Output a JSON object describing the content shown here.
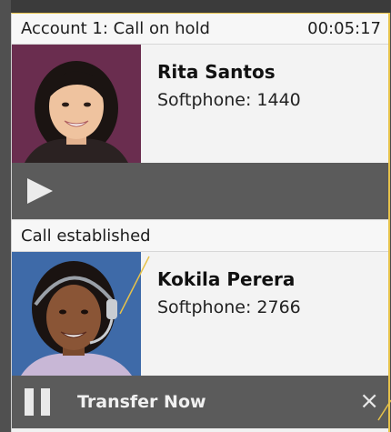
{
  "call1": {
    "status": "Account 1: Call on hold",
    "timer": "00:05:17",
    "name": "Rita Santos",
    "number": "Softphone: 1440"
  },
  "call2": {
    "status": "Call established",
    "name": "Kokila Perera",
    "number": "Softphone: 2766",
    "transfer_label": "Transfer Now",
    "close_label": "×"
  },
  "colors": {
    "avatar1_bg": "#6a2d4f",
    "avatar2_bg": "#3e6aa8",
    "bar_bg": "#5b5b5b",
    "accent_line": "#e6c24a"
  },
  "icons": {
    "play": "play-icon",
    "pause": "pause-icon",
    "close": "close-icon"
  }
}
